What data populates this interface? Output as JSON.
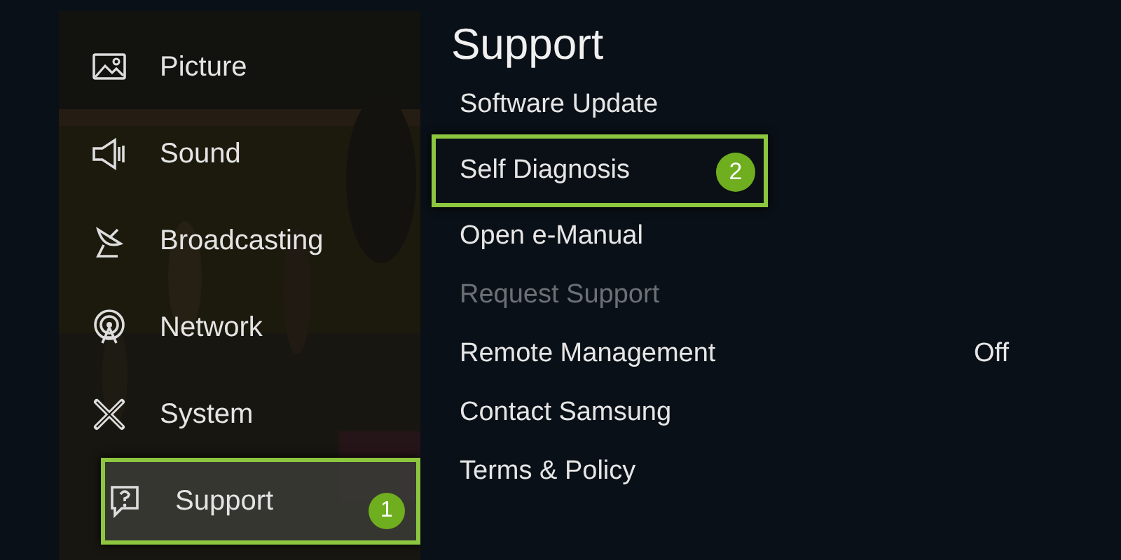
{
  "sidebar": {
    "items": [
      {
        "label": "Picture",
        "selected": false
      },
      {
        "label": "Sound",
        "selected": false
      },
      {
        "label": "Broadcasting",
        "selected": false
      },
      {
        "label": "Network",
        "selected": false
      },
      {
        "label": "System",
        "selected": false
      },
      {
        "label": "Support",
        "selected": true,
        "callout": "1"
      }
    ]
  },
  "panel": {
    "title": "Support",
    "items": [
      {
        "label": "Software Update",
        "disabled": false,
        "selected": false
      },
      {
        "label": "Self Diagnosis",
        "disabled": false,
        "selected": true,
        "callout": "2"
      },
      {
        "label": "Open e-Manual",
        "disabled": false,
        "selected": false
      },
      {
        "label": "Request Support",
        "disabled": true,
        "selected": false
      },
      {
        "label": "Remote Management",
        "disabled": false,
        "selected": false,
        "value": "Off"
      },
      {
        "label": "Contact Samsung",
        "disabled": false,
        "selected": false
      },
      {
        "label": "Terms & Policy",
        "disabled": false,
        "selected": false
      }
    ]
  }
}
